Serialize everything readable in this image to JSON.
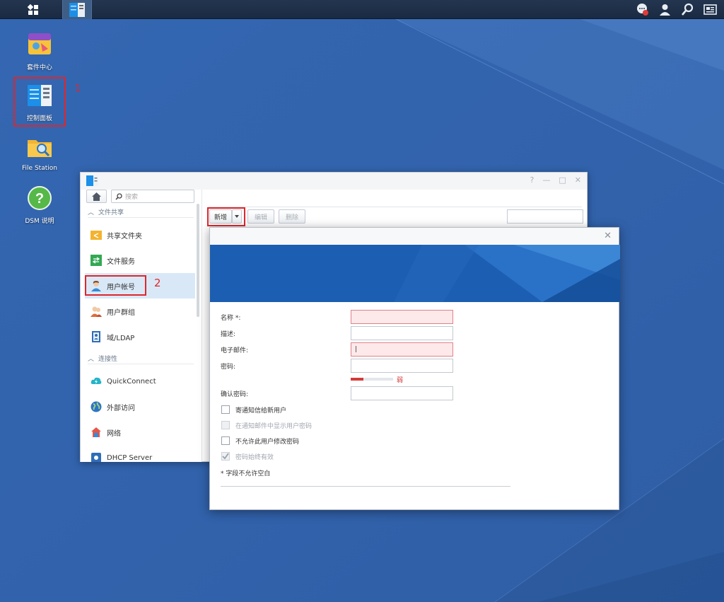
{
  "desktop": {
    "icons": [
      {
        "label": "套件中心",
        "icon": "package-center-icon"
      },
      {
        "label": "控制面板",
        "icon": "control-panel-icon"
      },
      {
        "label": "File Station",
        "icon": "folder-search-icon"
      },
      {
        "label": "DSM 说明",
        "icon": "help-icon"
      }
    ],
    "annotations": {
      "step1": "1",
      "step2": "2",
      "highlight_color": "#e0262b"
    }
  },
  "taskbar": {
    "right_icons": [
      "notification-icon",
      "user-icon",
      "search-icon",
      "widgets-icon"
    ]
  },
  "control_panel": {
    "window_buttons": [
      "?",
      "—",
      "□",
      "✕"
    ],
    "search_placeholder": "搜索",
    "sections": [
      {
        "label": "文件共享"
      },
      {
        "label": "连接性"
      }
    ],
    "items": [
      {
        "label": "共享文件夹",
        "icon": "shared-folder-icon"
      },
      {
        "label": "文件服务",
        "icon": "file-services-icon"
      },
      {
        "label": "用户帐号",
        "icon": "user-account-icon",
        "selected": true
      },
      {
        "label": "用户群组",
        "icon": "user-group-icon"
      },
      {
        "label": "域/LDAP",
        "icon": "domain-ldap-icon"
      },
      {
        "label": "QuickConnect",
        "icon": "quickconnect-icon"
      },
      {
        "label": "外部访问",
        "icon": "external-access-icon"
      },
      {
        "label": "网络",
        "icon": "network-icon"
      },
      {
        "label": "DHCP Server",
        "icon": "dhcp-server-icon"
      }
    ],
    "toolbar": {
      "create": "新增",
      "edit": "编辑",
      "delete": "删除"
    }
  },
  "dialog": {
    "close": "✕",
    "fields": {
      "name_label": "名称 *:",
      "description_label": "描述:",
      "email_label": "电子邮件:",
      "email_value": "|",
      "password_label": "密码:",
      "password_strength": "弱",
      "password_strength_level": 0.3,
      "confirm_label": "确认密码:"
    },
    "options": [
      {
        "label": "寄通知信给新用户",
        "checked": false,
        "disabled": false
      },
      {
        "label": "在通知邮件中显示用户密码",
        "checked": false,
        "disabled": true
      },
      {
        "label": "不允许此用户修改密码",
        "checked": false,
        "disabled": false
      },
      {
        "label": "密码始终有效",
        "checked": true,
        "disabled": true
      }
    ],
    "note": "* 字段不允许空白"
  }
}
